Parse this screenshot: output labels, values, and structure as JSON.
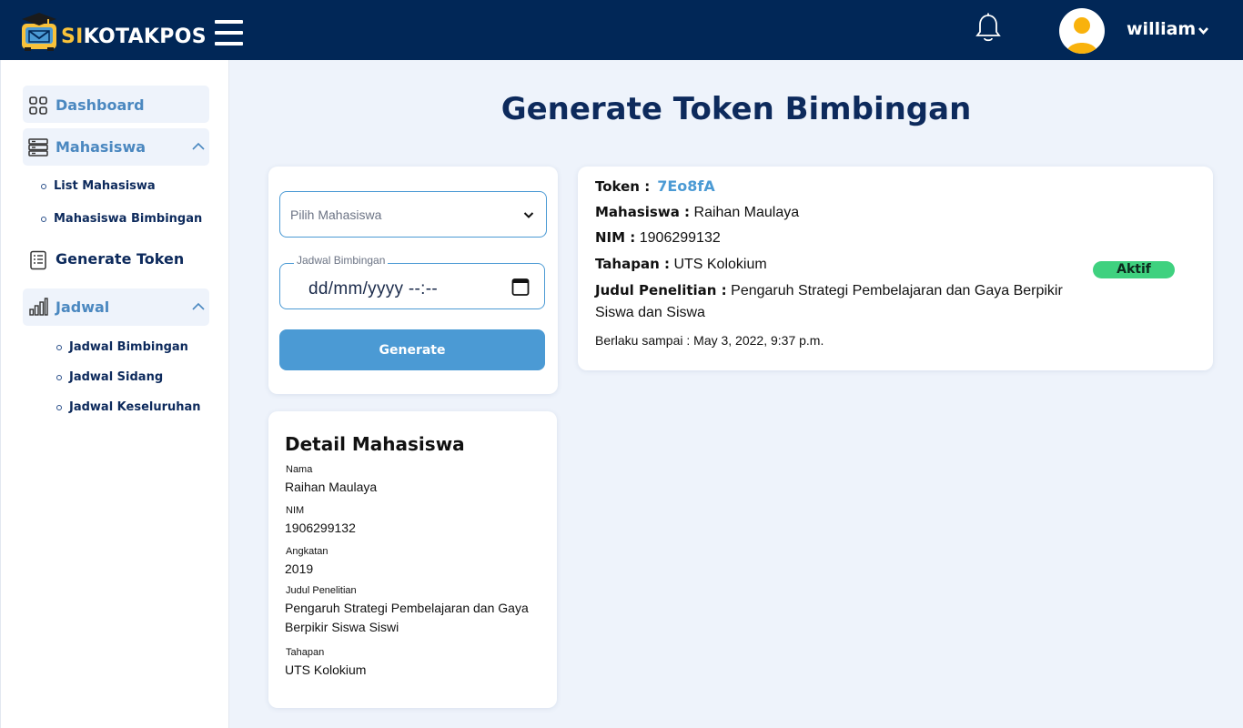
{
  "header": {
    "brand_prefix": "SI",
    "brand_rest": "KOTAKPOS",
    "username": "william",
    "icons": [
      "logo-icon",
      "menu-icon",
      "bell-icon",
      "user-avatar-icon",
      "chevron-down-icon"
    ]
  },
  "sidebar": {
    "dashboard": "Dashboard",
    "mahasiswa": "Mahasiswa",
    "list_mahasiswa": "List Mahasiswa",
    "mahasiswa_bimbingan": "Mahasiswa Bimbingan",
    "generate_token": "Generate Token",
    "jadwal": "Jadwal",
    "jadwal_bimbingan": "Jadwal Bimbingan",
    "jadwal_sidang": "Jadwal Sidang",
    "jadwal_keseluruhan": "Jadwal Keseluruhan"
  },
  "page": {
    "title": "Generate Token Bimbingan"
  },
  "form": {
    "select_placeholder": "Pilih Mahasiswa",
    "date_label": "Jadwal Bimbingan",
    "date_value": "dd/mm/yyyy --:--",
    "generate_label": "Generate"
  },
  "detail": {
    "title": "Detail Mahasiswa",
    "nama_label": "Nama",
    "nama": "Raihan Maulaya",
    "nim_label": "NIM",
    "nim": "1906299132",
    "angkatan_label": "Angkatan",
    "angkatan": "2019",
    "judul_label": "Judul Penelitian",
    "judul": "Pengaruh Strategi Pembelajaran dan Gaya Berpikir Siswa Siswi",
    "tahapan_label": "Tahapan",
    "tahapan": "UTS Kolokium"
  },
  "token_card": {
    "token_label": "Token :",
    "token": "7Eo8fA",
    "mahasiswa_label": "Mahasiswa :",
    "mahasiswa": "Raihan Maulaya",
    "nim_label": "NIM :",
    "nim": "1906299132",
    "tahapan_label": "Tahapan :",
    "tahapan": "UTS Kolokium",
    "judul_label": "Judul Penelitian :",
    "judul": "Pengaruh Strategi Pembelajaran dan Gaya Berpikir Siswa dan Siswa",
    "valid_until": "Berlaku sampai : May 3, 2022, 9:37 p.m.",
    "status": "Aktif",
    "status_color": "#3fd17f"
  },
  "colors": {
    "header_bg": "#012757",
    "accent": "#4b9ad4",
    "brand_yellow": "#f9c23a"
  }
}
